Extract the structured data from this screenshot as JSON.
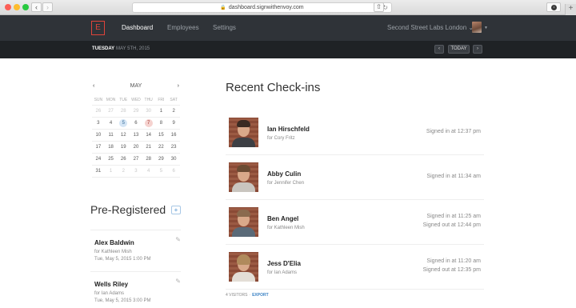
{
  "browser": {
    "url": "dashboard.signwithenvoy.com"
  },
  "header": {
    "logo_letter": "E",
    "nav": [
      {
        "label": "Dashboard",
        "active": true
      },
      {
        "label": "Employees",
        "active": false
      },
      {
        "label": "Settings",
        "active": false
      }
    ],
    "company": "Second Street Labs London ⌄"
  },
  "datebar": {
    "day": "TUESDAY",
    "date": "MAY 5TH, 2015",
    "today_label": "TODAY",
    "prev_label": "‹",
    "next_label": "›"
  },
  "calendar": {
    "month": "MAY",
    "prev_label": "‹",
    "next_label": "›",
    "weekdays": [
      "SUN",
      "MON",
      "TUE",
      "WED",
      "THU",
      "FRI",
      "SAT"
    ],
    "weeks": [
      [
        "26",
        "27",
        "28",
        "29",
        "30",
        "1",
        "2"
      ],
      [
        "3",
        "4",
        "5",
        "6",
        "7",
        "8",
        "9"
      ],
      [
        "10",
        "11",
        "12",
        "13",
        "14",
        "15",
        "16"
      ],
      [
        "17",
        "18",
        "19",
        "20",
        "21",
        "22",
        "23"
      ],
      [
        "24",
        "25",
        "26",
        "27",
        "28",
        "29",
        "30"
      ],
      [
        "31",
        "1",
        "2",
        "3",
        "4",
        "5",
        "6"
      ]
    ],
    "selected_day": "5",
    "today_day": "7",
    "accent_blue": "#d4e5f5",
    "accent_red": "#f5d2cf"
  },
  "preregistered": {
    "title": "Pre-Registered",
    "add_label": "+",
    "items": [
      {
        "name": "Alex Baldwin",
        "host": "for Kathleen Mish",
        "when": "Tue, May 5, 2015 1:00 PM"
      },
      {
        "name": "Wells Riley",
        "host": "for Ian Adams",
        "when": "Tue, May 5, 2015 3:00 PM"
      }
    ]
  },
  "recent": {
    "title": "Recent Check-ins",
    "checkins": [
      {
        "name": "Ian Hirschfeld",
        "host": "for Cory Fritz",
        "signed_in": "Signed in at 12:37 pm"
      },
      {
        "name": "Abby Culin",
        "host": "for Jennifer Chen",
        "signed_in": "Signed in at 11:34 am"
      },
      {
        "name": "Ben Angel",
        "host": "for Kathleen Mish",
        "signed_in": "Signed in at 11:25 am",
        "signed_out": "Signed out at 12:44 pm"
      },
      {
        "name": "Jess D'Elia",
        "host": "for Ian Adams",
        "signed_in": "Signed in at 11:20 am",
        "signed_out": "Signed out at 12:35 pm"
      }
    ],
    "footer": {
      "visitors": "4 VISITORS",
      "separator": "·",
      "export_label": "EXPORT"
    }
  }
}
